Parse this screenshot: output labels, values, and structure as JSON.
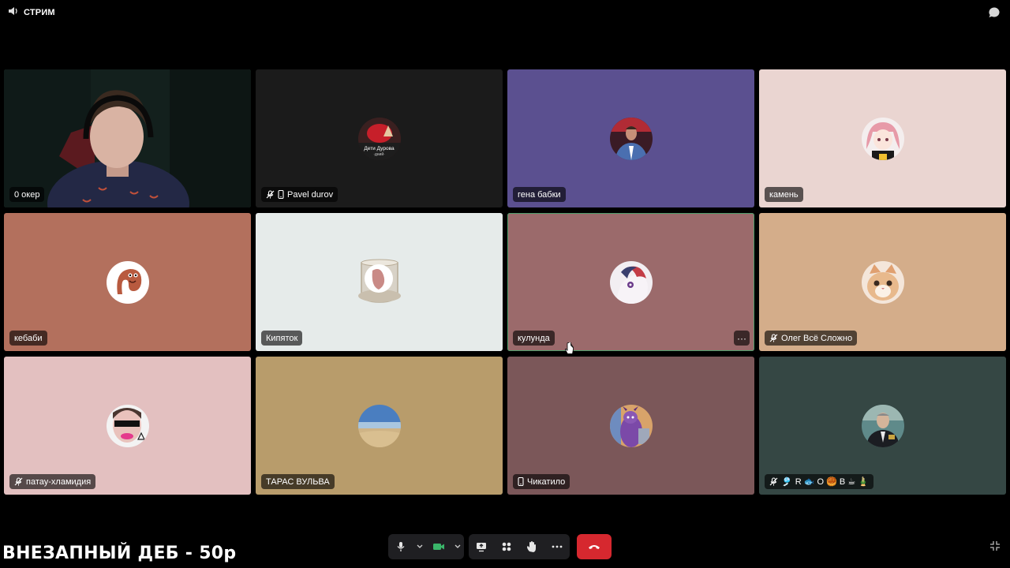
{
  "topbar": {
    "title": "СТРИМ"
  },
  "tiles": [
    {
      "name": "0 окер",
      "bg": "#1c2a26",
      "mic_off": false,
      "phone": false,
      "active": true,
      "video": true
    },
    {
      "name": "Pavel durov",
      "bg": "#1b1b1b",
      "mic_off": true,
      "phone": true,
      "avatar_text": "Дети Дурова",
      "avatar_sub": "·дний·"
    },
    {
      "name": "гена бабки",
      "bg": "#5b5090",
      "mic_off": false,
      "phone": false
    },
    {
      "name": "камень",
      "bg": "#ead5d1",
      "mic_off": false,
      "phone": false
    },
    {
      "name": "кебаби",
      "bg": "#b3705d",
      "mic_off": false,
      "phone": false
    },
    {
      "name": "Кипяток",
      "bg": "#e6ebea",
      "mic_off": false,
      "phone": false
    },
    {
      "name": "кулунда",
      "bg": "#9b6a6b",
      "mic_off": false,
      "phone": false,
      "active": true,
      "more": true
    },
    {
      "name": "Олег Всё Сложно",
      "bg": "#d4ad8a",
      "mic_off": true,
      "phone": false
    },
    {
      "name": "патау-хламидия",
      "bg": "#e3c0c0",
      "mic_off": true,
      "phone": false
    },
    {
      "name": "ТАРАС ВУЛЬВА",
      "bg": "#b89c6b",
      "mic_off": false,
      "phone": false
    },
    {
      "name": "Чикатило",
      "bg": "#7b5759",
      "mic_off": false,
      "phone": true
    },
    {
      "name": "R 🐟 O 🥮 B ☕ 🎍",
      "bg": "#354744",
      "mic_off": true,
      "phone": false,
      "prefix": "🎐"
    }
  ],
  "more_label": "···",
  "caption": "ВНЕЗАПНЫЙ ДЕБ - 50р",
  "colors": {
    "accent_green": "#4f9d6b",
    "hangup_red": "#d6282f",
    "control_bg": "#1f1f22"
  }
}
